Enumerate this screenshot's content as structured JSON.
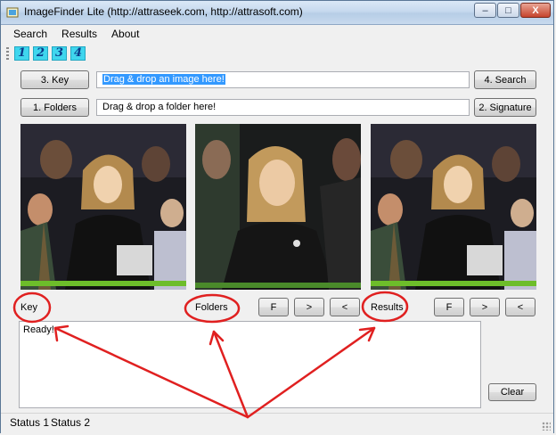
{
  "window": {
    "title": "ImageFinder Lite (http://attraseek.com, http://attrasoft.com)",
    "minimize_glyph": "–",
    "maximize_glyph": "□",
    "close_glyph": "X"
  },
  "menu": {
    "items": [
      "Search",
      "Results",
      "About"
    ]
  },
  "toolbar": {
    "buttons": [
      "1",
      "2",
      "3",
      "4"
    ]
  },
  "key_row": {
    "button_label": "3. Key",
    "input_value": "Drag & drop an image here!",
    "search_label": "4. Search"
  },
  "folder_row": {
    "button_label": "1. Folders",
    "input_value": "Drag & drop a folder here!",
    "signature_label": "2. Signature"
  },
  "labels": {
    "key": "Key",
    "folders": "Folders",
    "results": "Results"
  },
  "folder_nav": {
    "first": "F",
    "next": ">",
    "prev": "<"
  },
  "results_nav": {
    "first": "F",
    "next": ">",
    "prev": "<"
  },
  "status_text": {
    "value": "Ready!"
  },
  "clear_label": "Clear",
  "statusbar": {
    "status1": "Status 1",
    "status2": "Status 2"
  },
  "annotation_color": "#e02020"
}
